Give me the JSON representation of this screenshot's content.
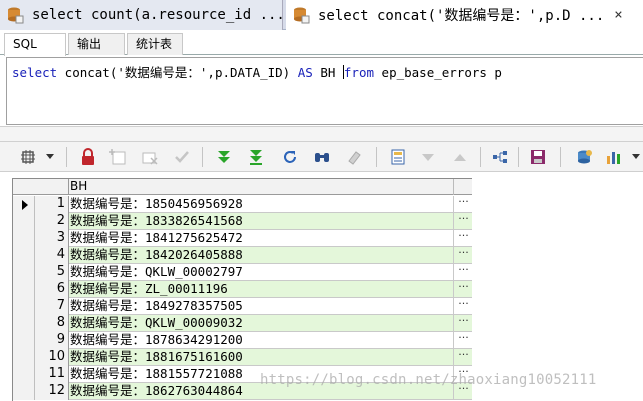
{
  "doc_tabs": [
    {
      "label": "select count(a.resource_id ...",
      "active": false
    },
    {
      "label": "select concat('数据编号是：',p.D ...",
      "active": true
    }
  ],
  "close_glyph": "×",
  "sub_tabs": [
    {
      "label": "SQL",
      "active": true
    },
    {
      "label": "输出",
      "active": false
    },
    {
      "label": "统计表",
      "active": false
    }
  ],
  "editor": {
    "sql_parts": [
      {
        "t": "select",
        "kw": true
      },
      {
        "t": " concat('数据编号是：',p.DATA_ID) ",
        "kw": false
      },
      {
        "t": "AS",
        "kw": true
      },
      {
        "t": " BH ",
        "kw": false
      },
      {
        "t": "from",
        "kw": true
      },
      {
        "t": " ep_base_errors p",
        "kw": false
      }
    ]
  },
  "toolbar": {
    "icons": [
      "grid-settings-icon",
      "lock-icon",
      "insert-row-icon",
      "delete-row-icon",
      "post-check-icon",
      "fetch-next-icon",
      "fetch-all-icon",
      "refresh-icon",
      "find-icon",
      "clear-icon",
      "single-record-icon",
      "sort-desc-icon",
      "sort-asc-icon",
      "connection-icon",
      "save-icon",
      "export-icon",
      "chart-icon"
    ]
  },
  "grid": {
    "column_header": "BH",
    "cell_button": "···",
    "rows": [
      {
        "n": "1",
        "value": "数据编号是：1850456956928",
        "current": true
      },
      {
        "n": "2",
        "value": "数据编号是：1833826541568",
        "current": false
      },
      {
        "n": "3",
        "value": "数据编号是：1841275625472",
        "current": false
      },
      {
        "n": "4",
        "value": "数据编号是：1842026405888",
        "current": false
      },
      {
        "n": "5",
        "value": "数据编号是：QKLW_00002797",
        "current": false
      },
      {
        "n": "6",
        "value": "数据编号是：ZL_00011196",
        "current": false
      },
      {
        "n": "7",
        "value": "数据编号是：1849278357505",
        "current": false
      },
      {
        "n": "8",
        "value": "数据编号是：QKLW_00009032",
        "current": false
      },
      {
        "n": "9",
        "value": "数据编号是：1878634291200",
        "current": false
      },
      {
        "n": "10",
        "value": "数据编号是：1881675161600",
        "current": false
      },
      {
        "n": "11",
        "value": "数据编号是：1881557721088",
        "current": false
      },
      {
        "n": "12",
        "value": "数据编号是：1862763044864",
        "current": false
      }
    ]
  },
  "watermark": "https://blog.csdn.net/zhaoxiang10052111",
  "colors": {
    "keyword": "#1a22b9",
    "alt_row": "#e4f7da",
    "green_arrows": "#2aa52a",
    "red_lock": "#c0262c"
  }
}
